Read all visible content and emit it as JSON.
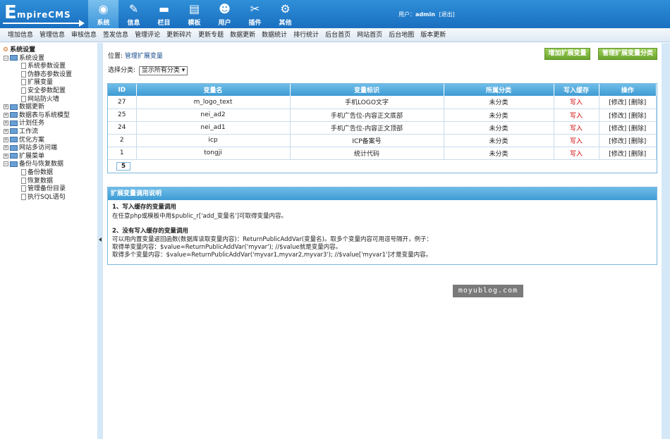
{
  "logo": {
    "letter": "E",
    "rest": "mpireCMS"
  },
  "nav": [
    {
      "label": "系统",
      "icon": "globe-icon",
      "glyph": "◉",
      "active": true
    },
    {
      "label": "信息",
      "icon": "pencil-icon",
      "glyph": "✎"
    },
    {
      "label": "栏目",
      "icon": "folder-icon",
      "glyph": "▬"
    },
    {
      "label": "模板",
      "icon": "template-icon",
      "glyph": "▤"
    },
    {
      "label": "用户",
      "icon": "user-icon",
      "glyph": "☻"
    },
    {
      "label": "插件",
      "icon": "tools-icon",
      "glyph": "✂"
    },
    {
      "label": "其他",
      "icon": "gear-icon",
      "glyph": "⚙"
    }
  ],
  "user": {
    "prefix": "用户：",
    "name": "admin",
    "logout": "[退出]"
  },
  "subnav": [
    "增加信息",
    "管理信息",
    "审核信息",
    "签发信息",
    "管理评论",
    "更新碎片",
    "更新专题",
    "数据更新",
    "数据统计",
    "排行统计",
    "后台首页",
    "网站首页",
    "后台地图",
    "版本更新"
  ],
  "tree": [
    {
      "label": "系统设置",
      "type": "root"
    },
    {
      "label": "系统设置",
      "type": "open",
      "indent": 1
    },
    {
      "label": "系统参数设置",
      "type": "leaf",
      "indent": 2
    },
    {
      "label": "伪静态参数设置",
      "type": "leaf",
      "indent": 2
    },
    {
      "label": "扩展变量",
      "type": "leaf",
      "indent": 2
    },
    {
      "label": "安全参数配置",
      "type": "leaf",
      "indent": 2
    },
    {
      "label": "网站防火墙",
      "type": "leaf",
      "indent": 2
    },
    {
      "label": "数据更新",
      "type": "closed",
      "indent": 1
    },
    {
      "label": "数据表与系统模型",
      "type": "closed",
      "indent": 1
    },
    {
      "label": "计划任务",
      "type": "closed",
      "indent": 1
    },
    {
      "label": "工作流",
      "type": "closed",
      "indent": 1
    },
    {
      "label": "优化方案",
      "type": "closed",
      "indent": 1
    },
    {
      "label": "网站多访问端",
      "type": "closed",
      "indent": 1
    },
    {
      "label": "扩展菜单",
      "type": "closed",
      "indent": 1
    },
    {
      "label": "备份与恢复数据",
      "type": "open",
      "indent": 1
    },
    {
      "label": "备份数据",
      "type": "leaf",
      "indent": 2
    },
    {
      "label": "恢复数据",
      "type": "leaf",
      "indent": 2
    },
    {
      "label": "管理备份目录",
      "type": "leaf",
      "indent": 2
    },
    {
      "label": "执行SQL语句",
      "type": "leaf",
      "indent": 2
    }
  ],
  "location": {
    "prefix": "位置:",
    "link": "管理扩展变量"
  },
  "category": {
    "label": "选择分类:",
    "value": "显示所有分类"
  },
  "buttons": {
    "add": "增加扩展变量",
    "manage": "管理扩展变量分类"
  },
  "table": {
    "headers": [
      "ID",
      "变量名",
      "变量标识",
      "所属分类",
      "写入缓存",
      "操作"
    ],
    "rows": [
      [
        "27",
        "m_logo_text",
        "手机LOGO文字",
        "未分类",
        "写入",
        "[修改] [删除]"
      ],
      [
        "25",
        "nei_ad2",
        "手机广告位-内容正文底部",
        "未分类",
        "写入",
        "[修改] [删除]"
      ],
      [
        "24",
        "nei_ad1",
        "手机广告位-内容正文顶部",
        "未分类",
        "写入",
        "[修改] [删除]"
      ],
      [
        "2",
        "icp",
        "ICP备案号",
        "未分类",
        "写入",
        "[修改] [删除]"
      ],
      [
        "1",
        "tongji",
        "统计代码",
        "未分类",
        "写入",
        "[修改] [删除]"
      ]
    ],
    "pager": "5"
  },
  "help": {
    "title": "扩展变量调用说明",
    "h1": "1、写入缓存的变量调用",
    "p1": "在任意php或模板中用$public_r['add_变量名']可取得变量内容。",
    "h2": "2、没有写入缓存的变量调用",
    "p2": "可以用内置变量返回函数(数据库读取变量内容)：ReturnPublicAddVar(变量名)。取多个变量内容可用逗号隔开，例子：",
    "p3": "取得单变量内容：$value=ReturnPublicAddVar('myvar'); //$value就是变量内容。",
    "p4": "取得多个变量内容：$value=ReturnPublicAddVar('myvar1,myvar2,myvar3'); //$value['myvar1']才是变量内容。"
  },
  "watermark": "moyublog.com"
}
